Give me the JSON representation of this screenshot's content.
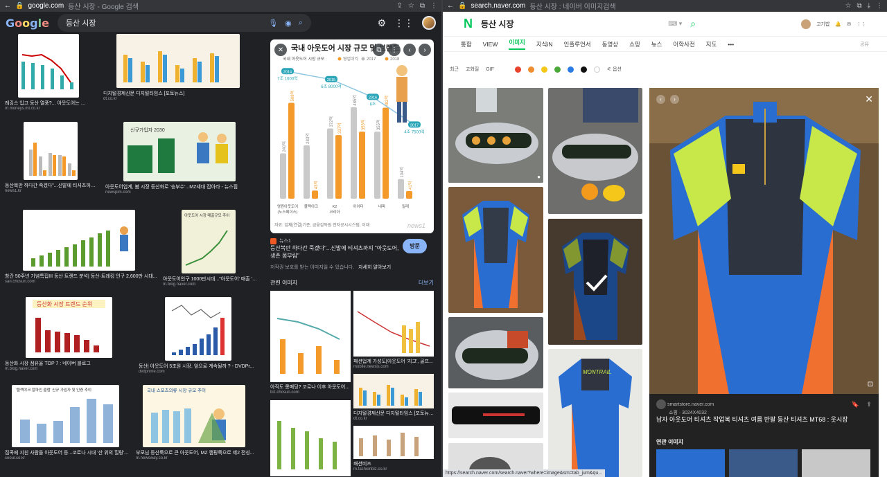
{
  "left": {
    "browser": {
      "host": "google.com",
      "rest": "등산 시장 - Google 검색"
    },
    "search": {
      "query": "등산 시장"
    },
    "tiles": [
      {
        "caption": "레깅스 입고 등산 열풍?... 아웃도어는 여전...",
        "source": "m.moneys.mt.co.kr"
      },
      {
        "caption": "디지털경제신문 디지털타임스 [포토뉴스]",
        "source": "dt.co.kr"
      },
      {
        "caption": "등산복만 하다간 죽겠다\"...신발에 티셔츠까지...",
        "source": "news1.kr"
      },
      {
        "caption": "아웃도어업계, 봄 시장 등산화로 '승부수'...MZ세대 잡아라 - 뉴스핌",
        "source": "newspim.com"
      },
      {
        "caption": "창간 50주년 기념특집III 등산 트렌드 분석| 등산·트레킹 인구 2,600만 시대...",
        "source": "san.chosun.com"
      },
      {
        "caption": "아웃도어인구 1000만시대...\"아웃도어' 매출 '고공...",
        "source": "m.blog.naver.com"
      },
      {
        "caption": "등산화 시장 점유율 TOP 7 : 네이버 블로그",
        "source": "m.blog.naver.com"
      },
      {
        "caption": "등산| 아웃도어 5조원 시장. 앞으로 계속될까 ? - DVDPr...",
        "source": "dvdprime.com"
      },
      {
        "caption": "집콕에 지친 사람들 아웃도어 등...코로나 시대 '산 위의 힐링'...",
        "source": "seoul.co.kr"
      },
      {
        "caption": "부모님 등산룩으로 큰 아웃도어, MZ 캠핑룩으로 제2 전성...",
        "source": "m.newsway.co.kr"
      }
    ],
    "tile_labels": {
      "hiking_trend": "등산화 시장 트렌드 순위",
      "chart_2030": "신규가입자 2030",
      "sports_market": "국내 스포츠의류 시장 규모 추이",
      "club_chart": "'블랙야크 알파인 클럽' 신규 가입자 및 인증 추이",
      "sales_chart": "아웃도어 시장 매출규모 추이"
    },
    "preview": {
      "chart_title": "국내 아웃도어 시장 규모 및 브랜드",
      "chart_subtitle": "국내 아웃도어 시장 규모",
      "legend": [
        "영업이익",
        "2017",
        "2018"
      ],
      "source_label": "뉴스1",
      "title": "등산복만 하다간 죽겠다\"...신발에 티셔츠까지 \"아웃도어, 생존 몸부림\"",
      "visit": "방문",
      "note": "저작권 보호를 받는 이미지일 수 있습니다.",
      "note_link": "자세히 알아보기",
      "chart_foot": "자료: 업체(연결)기준, 금융감독원 전자공시시스템, 이재",
      "watermark": "news1"
    },
    "related": {
      "heading": "관련 이미지",
      "more": "더보기",
      "items": [
        {
          "caption": "아직도 롱패딩? 코로나 이후 아웃도어...",
          "source": "biz.chosun.com"
        },
        {
          "caption": "패션업계 가성도[아웃도어 '지고', 골프...",
          "source": "mobile.newsis.com"
        },
        {
          "caption": "디지털경제신문 디지털타임스 [포토뉴스...",
          "source": "dt.co.kr"
        },
        {
          "caption": "패션비즈",
          "source": "m.fashionbiz.co.kr"
        }
      ]
    }
  },
  "chart_data": {
    "type": "bar",
    "title": "국내 아웃도어 시장 규모 및 브랜드",
    "categories": [
      "영원아웃도어\n(노스페이스)",
      "블랙야크",
      "K2\n코리아",
      "아이더",
      "네파",
      "밀레"
    ],
    "series": [
      {
        "name": "2017",
        "values": [
          240,
          283,
          372,
          485,
          355,
          104
        ]
      },
      {
        "name": "2018",
        "values": [
          508,
          43,
          337,
          355,
          482,
          41
        ]
      }
    ],
    "line": {
      "labels": [
        "2014 7조 1600억",
        "2015 6조 8000억",
        "2016 6조",
        "2017 4조 7500억"
      ],
      "values": [
        71600,
        68000,
        60000,
        47500
      ]
    }
  },
  "right": {
    "browser": {
      "host": "search.naver.com",
      "rest": "등산 시장 : 네이버 이미지검색"
    },
    "logo": "N",
    "query": "등산 시장",
    "user": "고기밥",
    "tabs": [
      "통합",
      "VIEW",
      "이미지",
      "지식iN",
      "인플루언서",
      "동영상",
      "쇼핑",
      "뉴스",
      "어학사전",
      "지도",
      "•••"
    ],
    "active_tab": "이미지",
    "share": "공유",
    "filters": [
      "최근",
      "고화질",
      "GIF"
    ],
    "filter_colors": [
      "#e8412c",
      "#f08d2f",
      "#f5c71a",
      "#4caa3a",
      "#2a7be4",
      "#111111",
      "#ffffff"
    ],
    "filter_option": "옵션",
    "detail": {
      "site": "smartstore.naver.com",
      "meta": "쇼핑 · 3024X4032",
      "title": "남자 아웃도어 티셔츠 작업복 티셔츠 여름 반팔 등산 티셔츠 MT68 : 웃시장",
      "related": "연관 이미지",
      "shirt_brand": "MONTRAIL"
    },
    "status_url": "https://search.naver.com/search.naver?where=image&sm=tab_jum&qu..."
  }
}
